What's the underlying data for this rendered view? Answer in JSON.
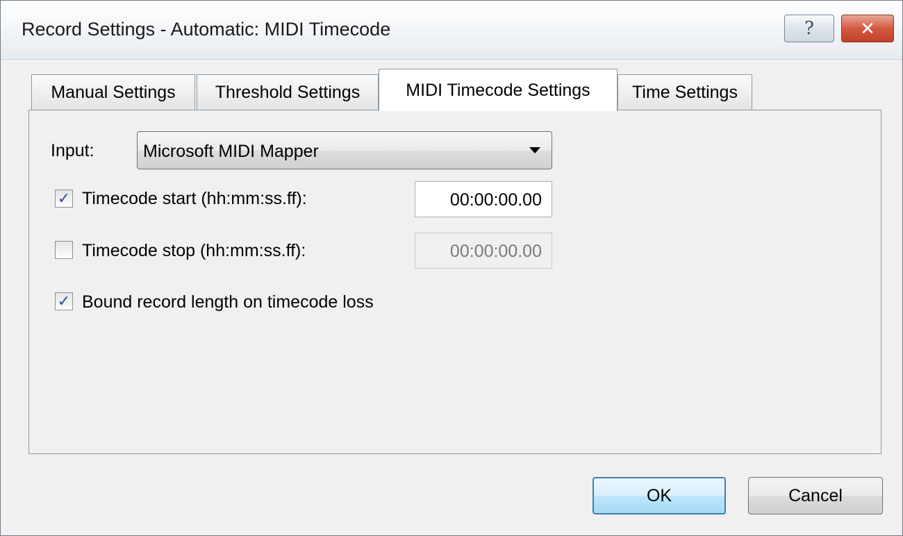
{
  "window": {
    "title": "Record Settings - Automatic: MIDI Timecode",
    "help_glyph": "?",
    "close_glyph": "✕"
  },
  "tabs": [
    {
      "label": "Manual Settings",
      "active": false
    },
    {
      "label": "Threshold Settings",
      "active": false
    },
    {
      "label": "MIDI Timecode Settings",
      "active": true
    },
    {
      "label": "Time Settings",
      "active": false
    }
  ],
  "midi": {
    "input_label": "Input:",
    "input_value": "Microsoft MIDI Mapper",
    "start": {
      "label": "Timecode start (hh:mm:ss.ff):",
      "checked": true,
      "value": "00:00:00.00"
    },
    "stop": {
      "label": "Timecode stop (hh:mm:ss.ff):",
      "checked": false,
      "value": "00:00:00.00"
    },
    "bound": {
      "label": "Bound record length on timecode loss",
      "checked": true
    }
  },
  "buttons": {
    "ok": "OK",
    "cancel": "Cancel"
  },
  "check_glyph": "✓",
  "icons": {
    "help": "help-icon",
    "close": "close-icon",
    "dropdown": "chevron-down-icon"
  }
}
